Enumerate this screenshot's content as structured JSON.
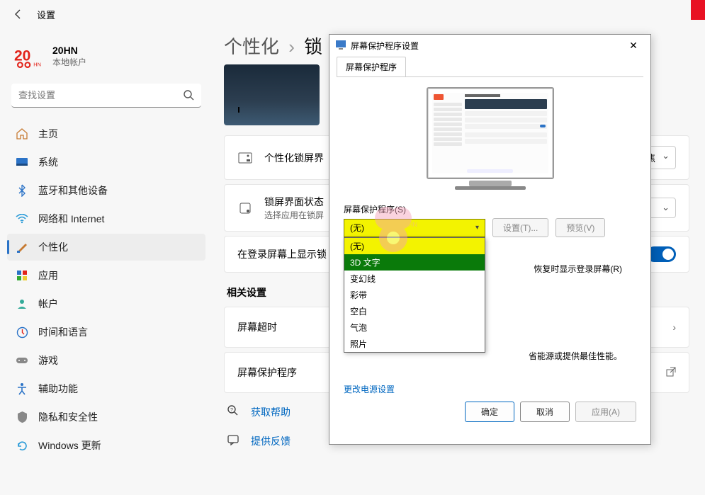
{
  "window": {
    "title": "设置"
  },
  "profile": {
    "name": "20HN",
    "sub": "本地帐户"
  },
  "search": {
    "placeholder": "查找设置"
  },
  "nav": {
    "home": "主页",
    "system": "系统",
    "bluetooth": "蓝牙和其他设备",
    "network": "网络和 Internet",
    "personalize": "个性化",
    "apps": "应用",
    "accounts": "帐户",
    "time": "时间和语言",
    "gaming": "游戏",
    "accessibility": "辅助功能",
    "privacy": "隐私和安全性",
    "update": "Windows 更新"
  },
  "breadcrumb": {
    "parent": "个性化",
    "sep": "›",
    "current": "锁"
  },
  "cards": {
    "lock_personalize": "个性化锁屏界",
    "lock_status": {
      "title": "锁屏界面状态",
      "sub": "选择应用在锁屏"
    },
    "show_on_login": "在登录屏幕上显示锁",
    "focus_dd": "焦"
  },
  "related_header": "相关设置",
  "rows": {
    "timeout": "屏幕超时",
    "saver": "屏幕保护程序"
  },
  "help": {
    "get": "获取帮助",
    "feedback": "提供反馈"
  },
  "dialog": {
    "title": "屏幕保护程序设置",
    "tab": "屏幕保护程序",
    "section_label": "屏幕保护程序(S)",
    "current": "(无)",
    "options": {
      "none": "(无)",
      "text3d": "3D 文字",
      "mystify": "变幻线",
      "ribbons": "彩带",
      "blank": "空白",
      "bubbles": "气泡",
      "photos": "照片"
    },
    "settings_btn": "设置(T)...",
    "preview_btn": "预览(V)",
    "resume_label": "恢复时显示登录屏幕(R)",
    "pm_desc": "省能源或提供最佳性能。",
    "pm_link": "更改电源设置",
    "ok": "确定",
    "cancel": "取消",
    "apply": "应用(A)"
  }
}
